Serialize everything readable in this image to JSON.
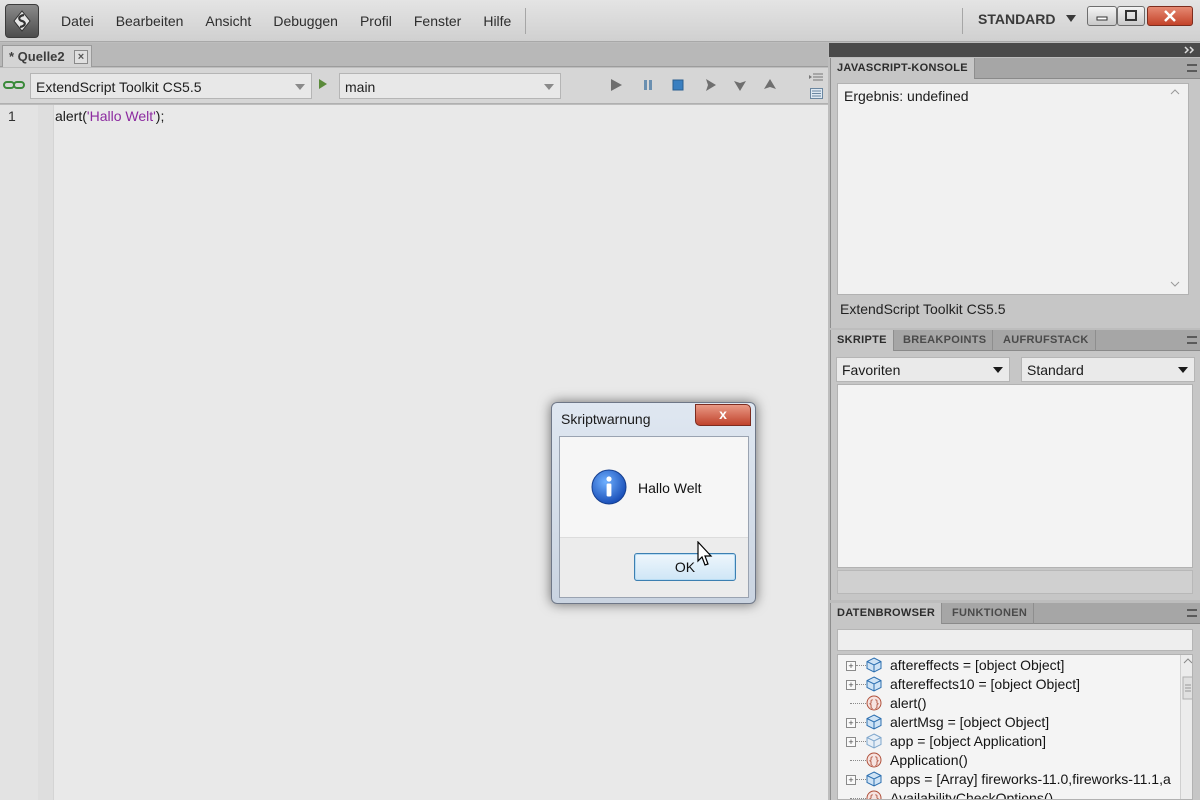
{
  "menubar": {
    "items": [
      "Datei",
      "Bearbeiten",
      "Ansicht",
      "Debuggen",
      "Profil",
      "Fenster",
      "Hilfe"
    ],
    "workspace": "STANDARD"
  },
  "editor": {
    "tab_label": "* Quelle2",
    "target_app": "ExtendScript Toolkit CS5.5",
    "engine": "main",
    "line_number": "1",
    "code_prefix": "alert(",
    "code_string": "'Hallo Welt'",
    "code_suffix": ");"
  },
  "console_panel": {
    "tab": "JAVASCRIPT-KONSOLE",
    "output": "Ergebnis: undefined",
    "status": "ExtendScript Toolkit CS5.5"
  },
  "scripts_panel": {
    "tabs": [
      "SKRIPTE",
      "BREAKPOINTS",
      "AUFRUFSTACK"
    ],
    "select_left": "Favoriten",
    "select_right": "Standard"
  },
  "data_browser": {
    "tabs": [
      "DATENBROWSER",
      "FUNKTIONEN"
    ],
    "items": [
      {
        "text": "aftereffects = [object Object]",
        "icon": "object-cube-icon",
        "expandable": true
      },
      {
        "text": "aftereffects10 = [object Object]",
        "icon": "object-cube-icon",
        "expandable": true
      },
      {
        "text": "alert()",
        "icon": "function-braces-icon",
        "expandable": false
      },
      {
        "text": "alertMsg = [object Object]",
        "icon": "object-cube-icon",
        "expandable": true
      },
      {
        "text": "app = [object Application]",
        "icon": "object-cube-light-icon",
        "expandable": true
      },
      {
        "text": "Application()",
        "icon": "function-braces-icon",
        "expandable": false
      },
      {
        "text": "apps = [Array] fireworks-11.0,fireworks-11.1,a",
        "icon": "object-cube-icon",
        "expandable": true
      },
      {
        "text": "AvailabilityCheckOptions()",
        "icon": "function-braces-icon",
        "expandable": false
      }
    ]
  },
  "dialog": {
    "title": "Skriptwarnung",
    "close": "x",
    "message": "Hallo Welt",
    "ok": "OK"
  },
  "colors": {
    "string_literal": "#8c2ba0",
    "dialog_close": "#c0432c",
    "ok_button_border": "#3c7fb1"
  }
}
